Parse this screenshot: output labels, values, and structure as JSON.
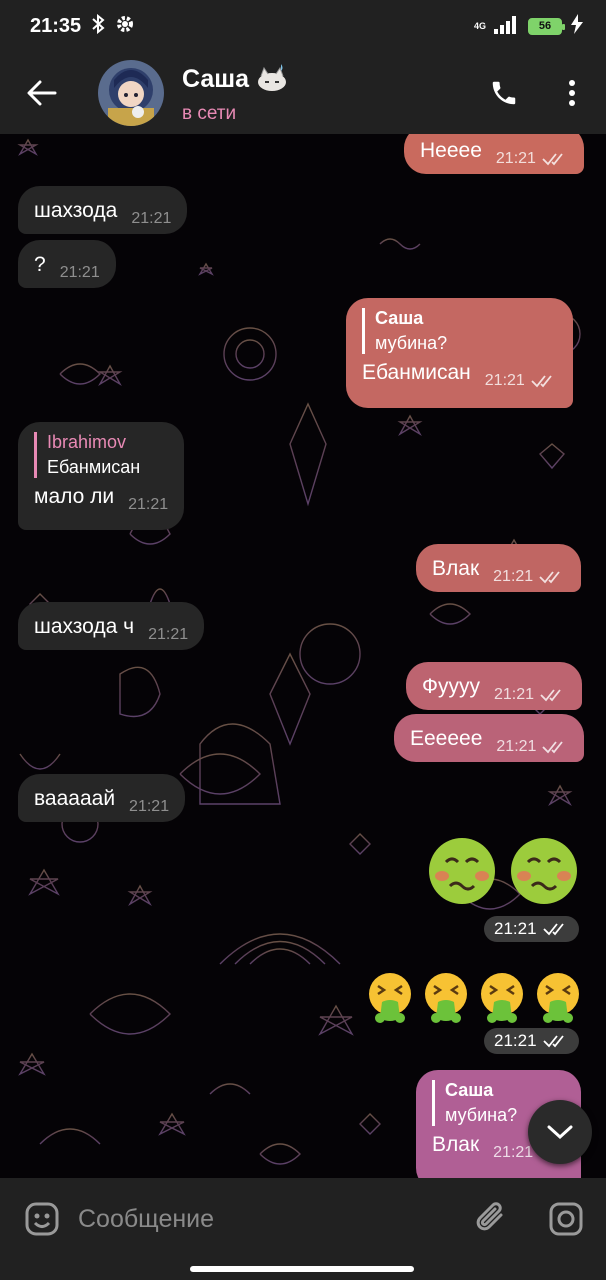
{
  "status_bar": {
    "time": "21:35",
    "network": "4G",
    "battery": "56"
  },
  "header": {
    "title": "Саша",
    "status": "в сети"
  },
  "messages": [
    {
      "text": "Неeee",
      "time": "21:21"
    },
    {
      "text": "шахзода",
      "time": "21:21"
    },
    {
      "text": "?",
      "time": "21:21"
    },
    {
      "reply_name": "Саша",
      "reply_text": "мубина?",
      "text": "Ебанмисан",
      "time": "21:21"
    },
    {
      "reply_name": "Ibrahimov",
      "reply_text": "Ебанмисан",
      "text": "мало ли",
      "time": "21:21"
    },
    {
      "text": "Влак",
      "time": "21:21"
    },
    {
      "text": "шахзода ч",
      "time": "21:21"
    },
    {
      "text": "Фуууу",
      "time": "21:21"
    },
    {
      "text": "Ееееее",
      "time": "21:21"
    },
    {
      "text": "вааааай",
      "time": "21:21"
    },
    {
      "emoji": "🤢🤢",
      "time": "21:21"
    },
    {
      "emoji": "🤮🤮🤮🤮",
      "time": "21:21"
    },
    {
      "reply_name": "Саша",
      "reply_text": "мубина?",
      "text": "Влак",
      "time": "21:21"
    }
  ],
  "composer": {
    "placeholder": "Сообщение"
  },
  "icons": {
    "back": "arrow-left-icon",
    "call": "phone-icon",
    "menu": "more-vert-icon",
    "emoji": "smiley-icon",
    "attach": "paperclip-icon",
    "camera": "camera-icon",
    "scroll": "chevron-down-icon",
    "read": "double-check-icon"
  },
  "colors": {
    "accent": "#e88ab5",
    "incoming_bubble": "#262626",
    "bar_bg": "#212121",
    "bubble_top": "#c96a5e",
    "bubble_bottom": "#b86190"
  }
}
